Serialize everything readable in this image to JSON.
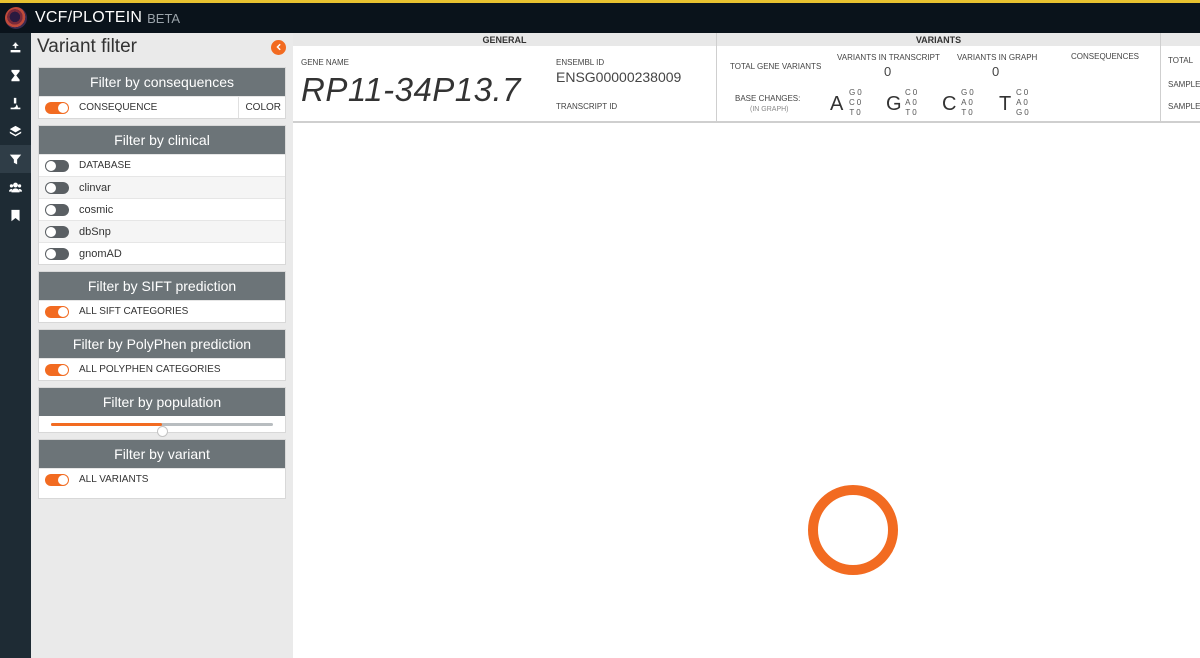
{
  "app": {
    "name": "VCF/PLOTEIN",
    "badge": "BETA"
  },
  "nav_icons": [
    "upload-icon",
    "hourglass-icon",
    "microscope-icon",
    "layers-icon",
    "filter-icon",
    "users-icon",
    "bookmark-icon"
  ],
  "sidebar": {
    "title": "Variant filter",
    "consequences": {
      "header": "Filter by consequences",
      "row_label": "CONSEQUENCE",
      "color_label": "COLOR"
    },
    "clinical": {
      "header": "Filter by clinical",
      "items": [
        "DATABASE",
        "clinvar",
        "cosmic",
        "dbSnp",
        "gnomAD"
      ]
    },
    "sift": {
      "header": "Filter by SIFT prediction",
      "row_label": "ALL SIFT CATEGORIES"
    },
    "polyphen": {
      "header": "Filter by PolyPhen prediction",
      "row_label": "ALL POLYPHEN CATEGORIES"
    },
    "population": {
      "header": "Filter by population",
      "slider_value": 0.5
    },
    "variant": {
      "header": "Filter by variant",
      "row_label": "ALL VARIANTS"
    }
  },
  "general": {
    "header": "GENERAL",
    "gene_name_label": "GENE NAME",
    "gene_name": "RP11-34P13.7",
    "ensembl_label": "ENSEMBL ID",
    "ensembl_id": "ENSG00000238009",
    "transcript_label": "TRANSCRIPT ID"
  },
  "variants": {
    "header": "VARIANTS",
    "total_label": "TOTAL GENE VARIANTS",
    "in_transcript_label": "VARIANTS IN TRANSCRIPT",
    "in_transcript_value": "0",
    "in_graph_label": "VARIANTS IN GRAPH",
    "in_graph_value": "0",
    "consequences_label": "CONSEQUENCES",
    "base_changes_label": "BASE CHANGES:",
    "base_changes_sub": "(IN GRAPH)",
    "bases": [
      {
        "letter": "A",
        "line1": "G0",
        "line2": "C0",
        "line3": "T0"
      },
      {
        "letter": "G",
        "line1": "C0",
        "line2": "A0",
        "line3": "T0"
      },
      {
        "letter": "C",
        "line1": "G0",
        "line2": "A0",
        "line3": "T0"
      },
      {
        "letter": "T",
        "line1": "C0",
        "line2": "A0",
        "line3": "G0"
      }
    ]
  },
  "right_partial": {
    "total_label": "TOTAL",
    "sample1_label": "SAMPLE",
    "sample2_label": "SAMPLE"
  },
  "colors": {
    "accent": "#f26b21",
    "topbar": "#0a131b",
    "iconbar": "#1e2b34",
    "panel_header": "#6c7478",
    "sidebar_bg": "#eaeaea"
  }
}
